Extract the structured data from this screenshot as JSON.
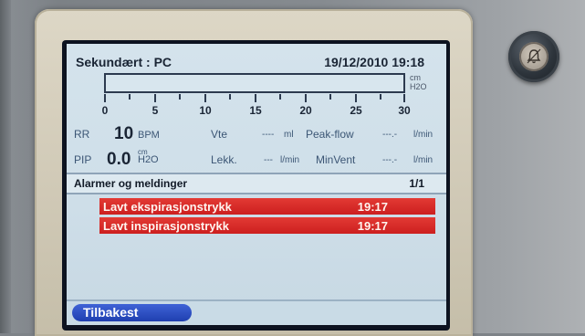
{
  "screen": {
    "title": "Sekundært : PC",
    "datetime": "19/12/2010 19:18"
  },
  "gauge": {
    "unit_top": "cm",
    "unit_bottom": "H2O",
    "fill_fraction": 0.0,
    "ticks": [
      "0",
      "5",
      "10",
      "15",
      "20",
      "25",
      "30"
    ]
  },
  "params": {
    "rr": {
      "label": "RR",
      "value": "10",
      "unit": "BPM"
    },
    "vte": {
      "label": "Vte",
      "value": "----",
      "unit": "ml"
    },
    "peak_flow": {
      "label": "Peak-flow",
      "value": "---.-",
      "unit": "l/min"
    },
    "pip": {
      "label": "PIP",
      "value": "0.0",
      "unit_top": "cm",
      "unit_bottom": "H2O"
    },
    "lekk": {
      "label": "Lekk.",
      "value": "---",
      "unit": "l/min"
    },
    "minvent": {
      "label": "MinVent",
      "value": "---.-",
      "unit": "l/min"
    }
  },
  "alarms": {
    "title": "Alarmer og meldinger",
    "page": "1/1",
    "items": [
      {
        "text": "Lavt ekspirasjonstrykk",
        "time": "19:17"
      },
      {
        "text": "Lavt inspirasjonstrykk",
        "time": "19:17"
      }
    ]
  },
  "bottom": {
    "back_label": "Tilbakest"
  },
  "hardware": {
    "alarm_button_icon": "bell-icon"
  },
  "colors": {
    "alarm_red": "#cc1f1f",
    "back_button_blue": "#1f3fb0",
    "screen_bg": "#d4e3ec"
  }
}
